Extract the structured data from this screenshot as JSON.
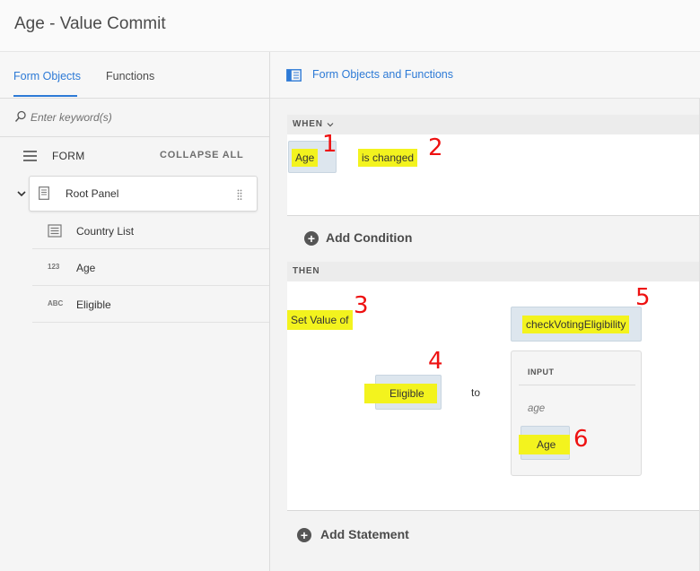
{
  "window": {
    "title": "Age - Value Commit"
  },
  "left_panel": {
    "tabs": [
      {
        "label": "Form Objects",
        "active": true
      },
      {
        "label": "Functions",
        "active": false
      }
    ],
    "search": {
      "placeholder": "Enter keyword(s)"
    },
    "form_header": {
      "label": "FORM",
      "collapse_label": "COLLAPSE ALL"
    },
    "tree": {
      "root": {
        "label": "Root Panel",
        "icon": "document-icon"
      },
      "items": [
        {
          "label": "Country List",
          "icon": "list-icon",
          "icon_text": ""
        },
        {
          "label": "Age",
          "icon": "numeric-icon",
          "icon_text": "123"
        },
        {
          "label": "Eligible",
          "icon": "text-icon",
          "icon_text": "ABC"
        }
      ]
    }
  },
  "right_panel": {
    "header_title": "Form Objects and Functions",
    "when": {
      "label": "WHEN",
      "field_token": "Age",
      "operator": "is changed"
    },
    "add_condition_label": "Add Condition",
    "then": {
      "label": "THEN",
      "action": "Set Value of",
      "target_token": "Eligible",
      "to_label": "to",
      "function_token": "checkVotingEligibility",
      "input_label": "INPUT",
      "param_name": "age",
      "param_token": "Age"
    },
    "add_statement_label": "Add Statement"
  },
  "annotations": [
    "1",
    "2",
    "3",
    "4",
    "5",
    "6"
  ],
  "colors": {
    "accent": "#2d7ad6",
    "highlight": "#f3f31e",
    "annotation": "#e11111"
  }
}
